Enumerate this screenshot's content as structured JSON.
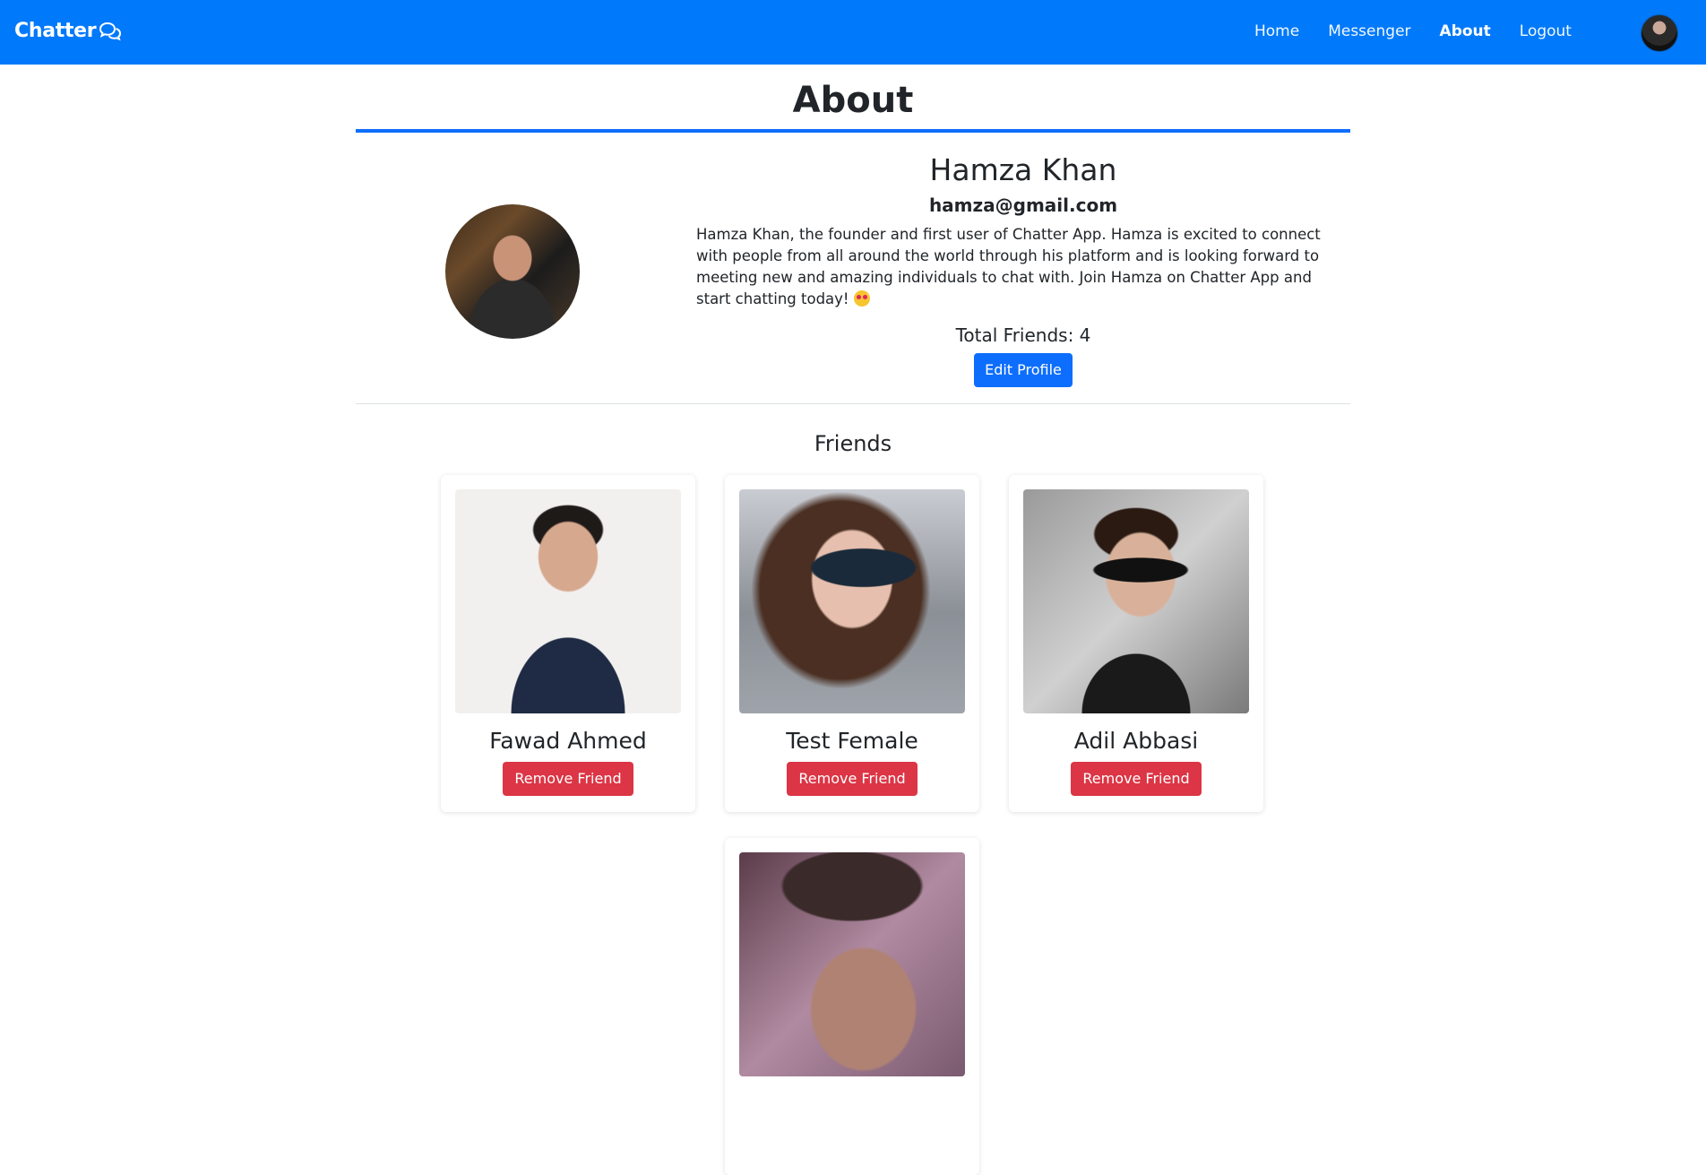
{
  "navbar": {
    "brand": "Chatter",
    "links": [
      {
        "label": "Home",
        "active": false
      },
      {
        "label": "Messenger",
        "active": false
      },
      {
        "label": "About",
        "active": true
      },
      {
        "label": "Logout",
        "active": false
      }
    ]
  },
  "page": {
    "title": "About"
  },
  "profile": {
    "name": "Hamza Khan",
    "email": "hamza@gmail.com",
    "bio": "Hamza Khan, the founder and first user of Chatter App. Hamza is excited to connect with people from all around the world through his platform and is looking forward to meeting new and amazing individuals to chat with. Join Hamza on Chatter App and start chatting today!",
    "total_friends": "Total Friends: 4",
    "edit_label": "Edit Profile"
  },
  "friends": {
    "heading": "Friends",
    "remove_label": "Remove Friend",
    "list": [
      {
        "name": "Fawad Ahmed"
      },
      {
        "name": "Test Female"
      },
      {
        "name": "Adil Abbasi"
      },
      {
        "name": ""
      }
    ]
  },
  "colors": {
    "navbar": "#0079fa",
    "primary": "#0d6efd",
    "danger": "#dc3545"
  }
}
